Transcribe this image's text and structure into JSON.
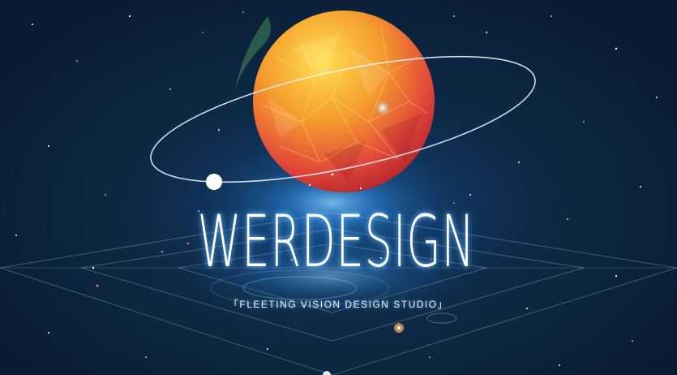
{
  "hero": {
    "title": "WERDESIGN",
    "subtitle": "「FLEETING VISION DESIGN STUDIO」"
  },
  "colors": {
    "background": "#0b1c30",
    "planet_highlight": "#ffd23a",
    "planet_shadow": "#e2403a",
    "glow": "#3a9cff"
  },
  "icons": [
    "planet-icon",
    "orbit-ring-icon",
    "satellite-dot-icon"
  ]
}
